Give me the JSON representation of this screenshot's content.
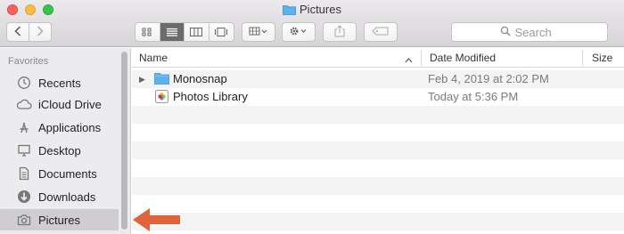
{
  "window": {
    "title": "Pictures"
  },
  "colors": {
    "folder_blue": "#4ba9ec",
    "arrow": "#e0643b",
    "selected_sidebar": "#cfcdd0"
  },
  "toolbar": {
    "back_icon": "chevron-left-icon",
    "forward_icon": "chevron-right-icon",
    "view_modes": [
      "icon-view",
      "list-view",
      "column-view",
      "gallery-view"
    ],
    "active_view": "list-view",
    "search_placeholder": "Search"
  },
  "sidebar": {
    "header": "Favorites",
    "items": [
      {
        "label": "Recents",
        "icon": "clock-icon"
      },
      {
        "label": "iCloud Drive",
        "icon": "cloud-icon"
      },
      {
        "label": "Applications",
        "icon": "applications-icon"
      },
      {
        "label": "Desktop",
        "icon": "desktop-icon"
      },
      {
        "label": "Documents",
        "icon": "documents-icon"
      },
      {
        "label": "Downloads",
        "icon": "download-icon"
      },
      {
        "label": "Pictures",
        "icon": "camera-icon",
        "selected": true
      }
    ]
  },
  "list": {
    "columns": {
      "name": "Name",
      "date": "Date Modified",
      "size": "Size"
    },
    "rows": [
      {
        "name": "Monosnap",
        "date": "Feb 4, 2019 at 2:02 PM",
        "icon": "folder-icon",
        "expandable": true
      },
      {
        "name": "Photos Library",
        "date": "Today at 5:36 PM",
        "icon": "photos-library-icon",
        "expandable": false
      }
    ]
  }
}
